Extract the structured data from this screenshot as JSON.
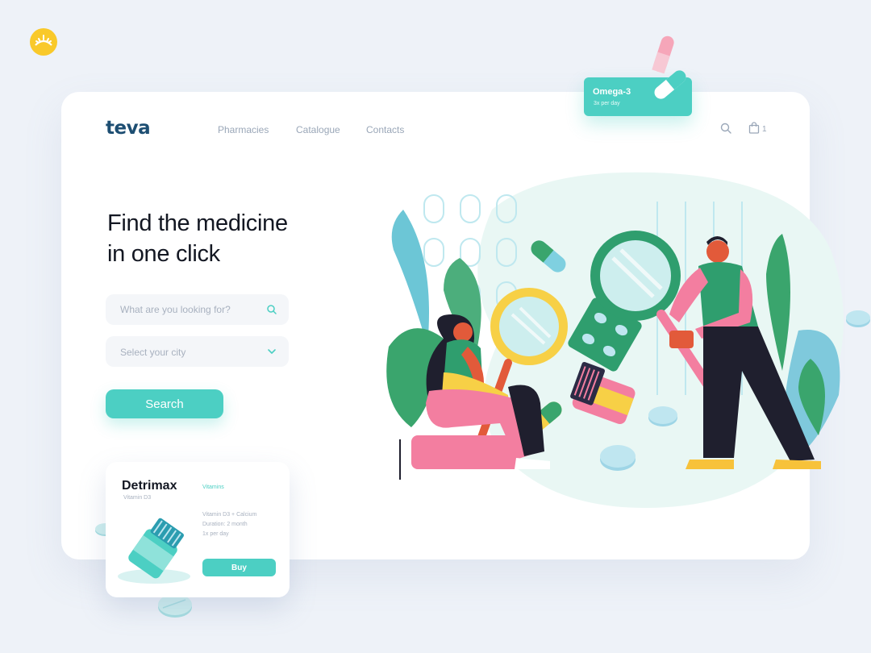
{
  "brand": {
    "logo_text": "teva"
  },
  "nav": {
    "items": [
      "Pharmacies",
      "Catalogue",
      "Contacts"
    ]
  },
  "header": {
    "cart_count": "1"
  },
  "hero": {
    "title_line1": "Find the medicine",
    "title_line2": "in one click"
  },
  "search": {
    "placeholder": "What are you looking for?",
    "city_placeholder": "Select your city",
    "button_label": "Search"
  },
  "product": {
    "name": "Detrimax",
    "subtitle": "Vitamin D3",
    "category": "Vitamins",
    "info": [
      "Vitamin D3 + Calcium",
      "Duration: 2 month",
      "1x per day"
    ],
    "buy_label": "Buy"
  },
  "floating_tag": {
    "title": "Omega-3",
    "subtitle": "3x per day"
  },
  "colors": {
    "accent": "#4ccfc3",
    "green": "#2f9e6e",
    "pink": "#f37ea0",
    "yellow": "#f7d046",
    "navy": "#1d4e72"
  },
  "icons": [
    "sun-logo-icon",
    "search-icon",
    "shopping-bag-icon",
    "chevron-down-icon",
    "pill-icon"
  ]
}
